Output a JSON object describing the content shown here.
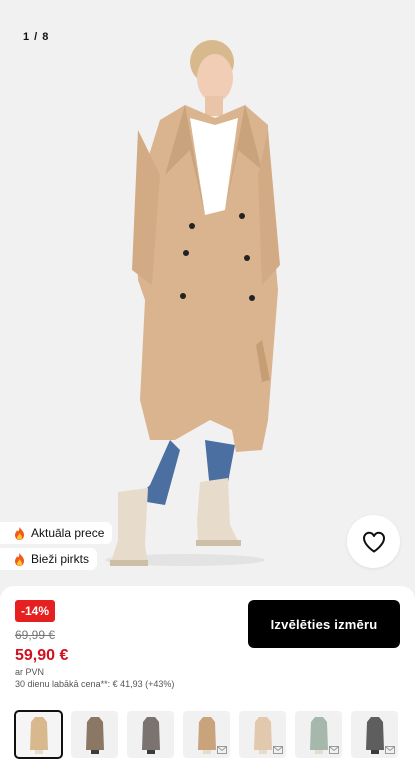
{
  "gallery": {
    "counter": "1 / 8",
    "coat_color": "#d9b48f",
    "badges": [
      {
        "label": "Aktuāla prece",
        "icon": "flame-icon"
      },
      {
        "label": "Bieži pirkts",
        "icon": "flame-icon"
      }
    ],
    "wishlist_icon": "heart-icon"
  },
  "product": {
    "discount": "-14%",
    "old_price": "69,99 €",
    "new_price": "59,90 €",
    "vat": "ar PVN",
    "lowest_price": "30 dienu labākā cena**: € 41,93 (+43%)",
    "choose_size": "Izvēlēties izmēru"
  },
  "swatches": [
    {
      "color": "#d8b98e",
      "selected": true,
      "notify": false
    },
    {
      "color": "#8a7865",
      "selected": false,
      "notify": false
    },
    {
      "color": "#7a7370",
      "selected": false,
      "notify": false
    },
    {
      "color": "#c9a37b",
      "selected": false,
      "notify": true
    },
    {
      "color": "#e2c8ad",
      "selected": false,
      "notify": true
    },
    {
      "color": "#a5b8ab",
      "selected": false,
      "notify": true
    },
    {
      "color": "#5e5e5e",
      "selected": false,
      "notify": true
    }
  ],
  "colors": {
    "discount": "#e62020",
    "sale_price": "#d0101f",
    "primary_button": "#000000"
  }
}
